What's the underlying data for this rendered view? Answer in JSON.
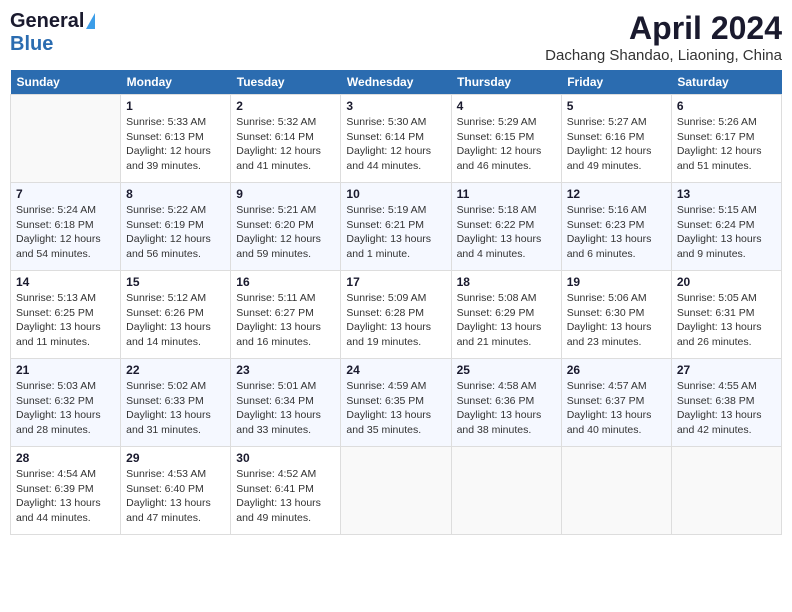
{
  "logo": {
    "general": "General",
    "blue": "Blue"
  },
  "title": "April 2024",
  "location": "Dachang Shandao, Liaoning, China",
  "weekdays": [
    "Sunday",
    "Monday",
    "Tuesday",
    "Wednesday",
    "Thursday",
    "Friday",
    "Saturday"
  ],
  "weeks": [
    [
      {
        "day": "",
        "info": ""
      },
      {
        "day": "1",
        "info": "Sunrise: 5:33 AM\nSunset: 6:13 PM\nDaylight: 12 hours\nand 39 minutes."
      },
      {
        "day": "2",
        "info": "Sunrise: 5:32 AM\nSunset: 6:14 PM\nDaylight: 12 hours\nand 41 minutes."
      },
      {
        "day": "3",
        "info": "Sunrise: 5:30 AM\nSunset: 6:14 PM\nDaylight: 12 hours\nand 44 minutes."
      },
      {
        "day": "4",
        "info": "Sunrise: 5:29 AM\nSunset: 6:15 PM\nDaylight: 12 hours\nand 46 minutes."
      },
      {
        "day": "5",
        "info": "Sunrise: 5:27 AM\nSunset: 6:16 PM\nDaylight: 12 hours\nand 49 minutes."
      },
      {
        "day": "6",
        "info": "Sunrise: 5:26 AM\nSunset: 6:17 PM\nDaylight: 12 hours\nand 51 minutes."
      }
    ],
    [
      {
        "day": "7",
        "info": "Sunrise: 5:24 AM\nSunset: 6:18 PM\nDaylight: 12 hours\nand 54 minutes."
      },
      {
        "day": "8",
        "info": "Sunrise: 5:22 AM\nSunset: 6:19 PM\nDaylight: 12 hours\nand 56 minutes."
      },
      {
        "day": "9",
        "info": "Sunrise: 5:21 AM\nSunset: 6:20 PM\nDaylight: 12 hours\nand 59 minutes."
      },
      {
        "day": "10",
        "info": "Sunrise: 5:19 AM\nSunset: 6:21 PM\nDaylight: 13 hours\nand 1 minute."
      },
      {
        "day": "11",
        "info": "Sunrise: 5:18 AM\nSunset: 6:22 PM\nDaylight: 13 hours\nand 4 minutes."
      },
      {
        "day": "12",
        "info": "Sunrise: 5:16 AM\nSunset: 6:23 PM\nDaylight: 13 hours\nand 6 minutes."
      },
      {
        "day": "13",
        "info": "Sunrise: 5:15 AM\nSunset: 6:24 PM\nDaylight: 13 hours\nand 9 minutes."
      }
    ],
    [
      {
        "day": "14",
        "info": "Sunrise: 5:13 AM\nSunset: 6:25 PM\nDaylight: 13 hours\nand 11 minutes."
      },
      {
        "day": "15",
        "info": "Sunrise: 5:12 AM\nSunset: 6:26 PM\nDaylight: 13 hours\nand 14 minutes."
      },
      {
        "day": "16",
        "info": "Sunrise: 5:11 AM\nSunset: 6:27 PM\nDaylight: 13 hours\nand 16 minutes."
      },
      {
        "day": "17",
        "info": "Sunrise: 5:09 AM\nSunset: 6:28 PM\nDaylight: 13 hours\nand 19 minutes."
      },
      {
        "day": "18",
        "info": "Sunrise: 5:08 AM\nSunset: 6:29 PM\nDaylight: 13 hours\nand 21 minutes."
      },
      {
        "day": "19",
        "info": "Sunrise: 5:06 AM\nSunset: 6:30 PM\nDaylight: 13 hours\nand 23 minutes."
      },
      {
        "day": "20",
        "info": "Sunrise: 5:05 AM\nSunset: 6:31 PM\nDaylight: 13 hours\nand 26 minutes."
      }
    ],
    [
      {
        "day": "21",
        "info": "Sunrise: 5:03 AM\nSunset: 6:32 PM\nDaylight: 13 hours\nand 28 minutes."
      },
      {
        "day": "22",
        "info": "Sunrise: 5:02 AM\nSunset: 6:33 PM\nDaylight: 13 hours\nand 31 minutes."
      },
      {
        "day": "23",
        "info": "Sunrise: 5:01 AM\nSunset: 6:34 PM\nDaylight: 13 hours\nand 33 minutes."
      },
      {
        "day": "24",
        "info": "Sunrise: 4:59 AM\nSunset: 6:35 PM\nDaylight: 13 hours\nand 35 minutes."
      },
      {
        "day": "25",
        "info": "Sunrise: 4:58 AM\nSunset: 6:36 PM\nDaylight: 13 hours\nand 38 minutes."
      },
      {
        "day": "26",
        "info": "Sunrise: 4:57 AM\nSunset: 6:37 PM\nDaylight: 13 hours\nand 40 minutes."
      },
      {
        "day": "27",
        "info": "Sunrise: 4:55 AM\nSunset: 6:38 PM\nDaylight: 13 hours\nand 42 minutes."
      }
    ],
    [
      {
        "day": "28",
        "info": "Sunrise: 4:54 AM\nSunset: 6:39 PM\nDaylight: 13 hours\nand 44 minutes."
      },
      {
        "day": "29",
        "info": "Sunrise: 4:53 AM\nSunset: 6:40 PM\nDaylight: 13 hours\nand 47 minutes."
      },
      {
        "day": "30",
        "info": "Sunrise: 4:52 AM\nSunset: 6:41 PM\nDaylight: 13 hours\nand 49 minutes."
      },
      {
        "day": "",
        "info": ""
      },
      {
        "day": "",
        "info": ""
      },
      {
        "day": "",
        "info": ""
      },
      {
        "day": "",
        "info": ""
      }
    ]
  ]
}
